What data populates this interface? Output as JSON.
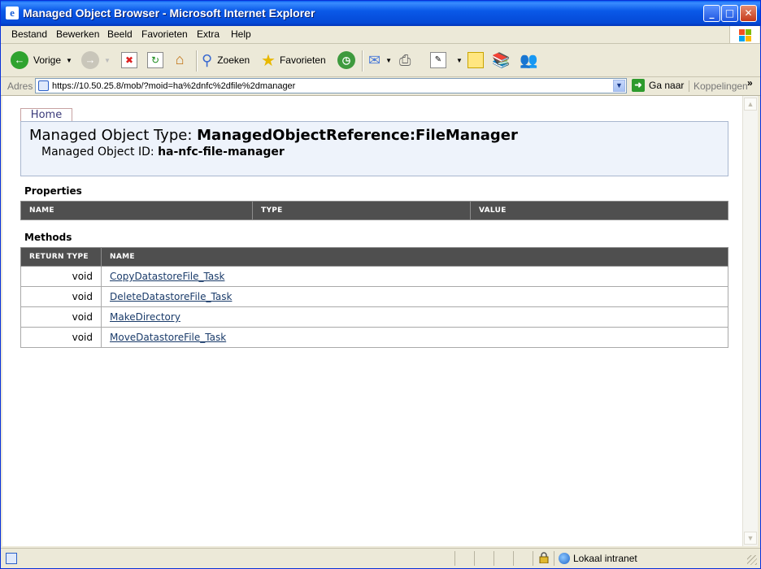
{
  "window": {
    "title": "Managed Object Browser - Microsoft Internet Explorer",
    "title_icon": "e"
  },
  "menu": [
    "Bestand",
    "Bewerken",
    "Beeld",
    "Favorieten",
    "Extra",
    "Help"
  ],
  "toolbar": {
    "back_label": "Vorige",
    "search_label": "Zoeken",
    "favorites_label": "Favorieten"
  },
  "address": {
    "label": "Adres",
    "url": "https://10.50.25.8/mob/?moid=ha%2dnfc%2dfile%2dmanager",
    "go_label": "Ga naar",
    "links_label": "Koppelingen",
    "more": "»"
  },
  "page": {
    "home_tab": "Home",
    "type_label": "Managed Object Type:",
    "type_value": "ManagedObjectReference:FileManager",
    "id_label": "Managed Object ID:",
    "id_value": "ha-nfc-file-manager",
    "properties_title": "Properties",
    "properties_headers": [
      "NAME",
      "TYPE",
      "VALUE"
    ],
    "methods_title": "Methods",
    "methods_headers": [
      "RETURN TYPE",
      "NAME"
    ],
    "methods": [
      {
        "return_type": "void",
        "name": "CopyDatastoreFile_Task"
      },
      {
        "return_type": "void",
        "name": "DeleteDatastoreFile_Task"
      },
      {
        "return_type": "void",
        "name": "MakeDirectory"
      },
      {
        "return_type": "void",
        "name": "MoveDatastoreFile_Task"
      }
    ]
  },
  "status": {
    "zone": "Lokaal intranet"
  },
  "icons": {
    "back": "back-arrow-icon",
    "forward": "forward-arrow-icon",
    "stop": "stop-icon",
    "refresh": "refresh-icon",
    "home": "home-icon",
    "search": "search-icon",
    "favorites": "favorites-star-icon",
    "history": "history-icon",
    "mail": "mail-icon",
    "print": "print-icon",
    "edit": "edit-icon",
    "discuss": "discuss-icon",
    "research": "research-icon",
    "messenger": "messenger-icon"
  },
  "colors": {
    "titlebar": "#0449d6",
    "table_header": "#4f4f4f",
    "header_box": "#eef3fb",
    "link": "#1a3b6a"
  }
}
